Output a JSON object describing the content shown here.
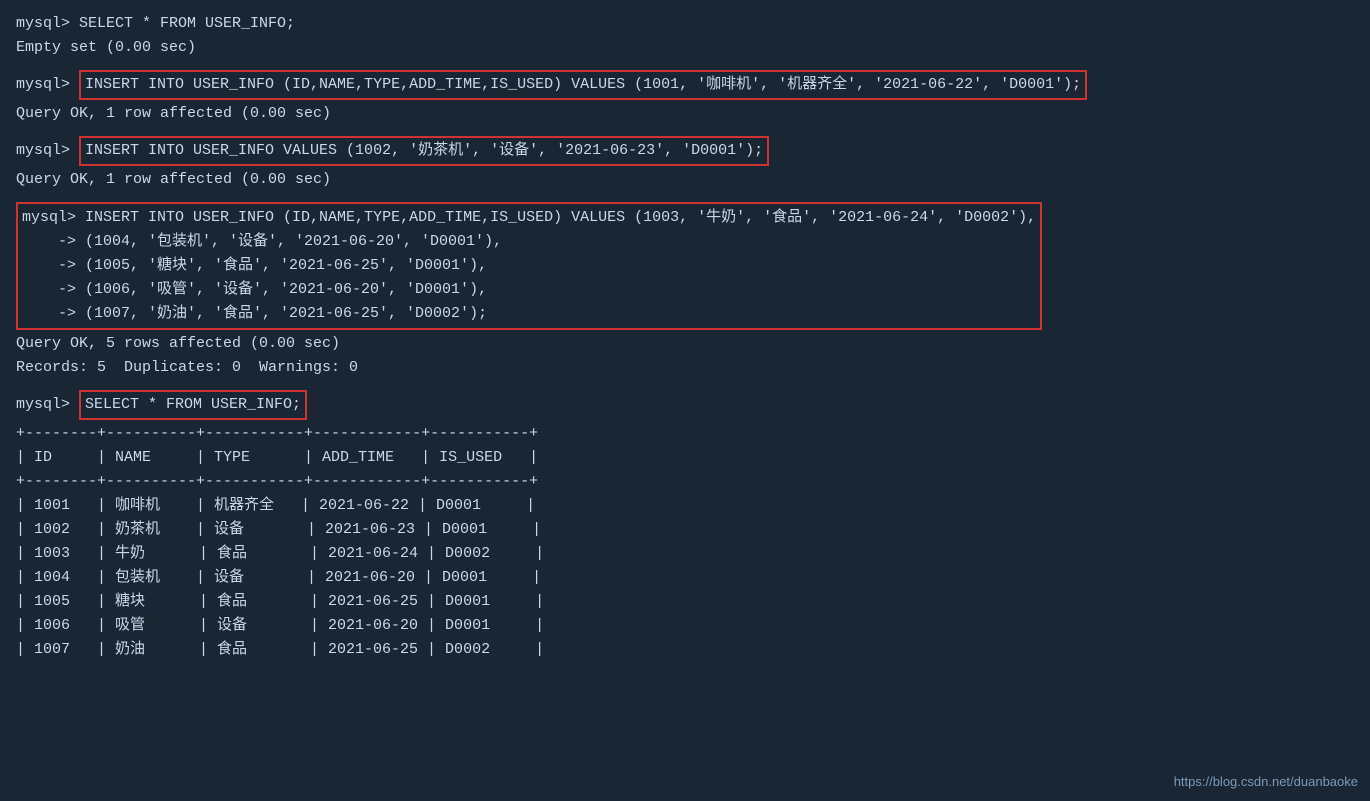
{
  "terminal": {
    "lines": [
      {
        "type": "prompt-line",
        "prompt": "mysql> ",
        "cmd": "SELECT * FROM USER_INFO;",
        "highlight": false
      },
      {
        "type": "result",
        "text": "Empty set (0.00 sec)",
        "highlight": false
      },
      {
        "type": "spacer"
      },
      {
        "type": "prompt-line",
        "prompt": "mysql> ",
        "cmd": "INSERT INTO USER_INFO (ID,NAME,TYPE,ADD_TIME,IS_USED) VALUES (1001, '咖啡机', '机器齐全', '2021-06-22', 'D0001');",
        "highlight": true
      },
      {
        "type": "result",
        "text": "Query OK, 1 row affected (0.00 sec)",
        "highlight": false
      },
      {
        "type": "spacer"
      },
      {
        "type": "prompt-line",
        "prompt": "mysql> ",
        "cmd": "INSERT INTO USER_INFO VALUES (1002, '奶茶机', '设备', '2021-06-23', 'D0001');",
        "highlight": true
      },
      {
        "type": "result",
        "text": "Query OK, 1 row affected (0.00 sec)",
        "highlight": false
      },
      {
        "type": "spacer"
      },
      {
        "type": "multiline-highlight-start",
        "prompt": "mysql> ",
        "cmd": "INSERT INTO USER_INFO (ID,NAME,TYPE,ADD_TIME,IS_USED) VALUES (1003, '牛奶', '食品', '2021-06-24', 'D0002'),"
      },
      {
        "type": "multiline-cont",
        "text": "    -> (1004, '包装机', '设备', '2021-06-20', 'D0001'),"
      },
      {
        "type": "multiline-cont",
        "text": "    -> (1005, '糖块', '食品', '2021-06-25', 'D0001'),"
      },
      {
        "type": "multiline-cont",
        "text": "    -> (1006, '吸管', '设备', '2021-06-20', 'D0001'),"
      },
      {
        "type": "multiline-cont-end",
        "text": "    -> (1007, '奶油', '食品', '2021-06-25', 'D0002');"
      },
      {
        "type": "result",
        "text": "Query OK, 5 rows affected (0.00 sec)",
        "highlight": false
      },
      {
        "type": "result",
        "text": "Records: 5  Duplicates: 0  Warnings: 0",
        "highlight": false
      },
      {
        "type": "spacer"
      },
      {
        "type": "prompt-line",
        "prompt": "mysql> ",
        "cmd": "SELECT * FROM USER_INFO;",
        "highlight": true
      },
      {
        "type": "table-border",
        "text": "+--------+----------+-----------+------------+-----------+"
      },
      {
        "type": "table-header",
        "text": "| ID     | NAME     | TYPE      | ADD_TIME   | IS_USED   |"
      },
      {
        "type": "table-border",
        "text": "+--------+----------+-----------+------------+-----------+"
      },
      {
        "type": "table-row-data",
        "text": "| 1001   | 咖啡机    | 机器齐全   | 2021-06-22 | D0001     |"
      },
      {
        "type": "table-row-data",
        "text": "| 1002   | 奶茶机    | 设备       | 2021-06-23 | D0001     |"
      },
      {
        "type": "table-row-data",
        "text": "| 1003   | 牛奶      | 食品       | 2021-06-24 | D0002     |"
      },
      {
        "type": "table-row-data",
        "text": "| 1004   | 包装机    | 设备       | 2021-06-20 | D0001     |"
      },
      {
        "type": "table-row-data",
        "text": "| 1005   | 糖块      | 食品       | 2021-06-25 | D0001     |"
      },
      {
        "type": "table-row-data",
        "text": "| 1006   | 吸管      | 设备       | 2021-06-20 | D0001     |"
      },
      {
        "type": "table-row-data",
        "text": "| 1007   | 奶油      | 食品       | 2021-06-25 | D0002     |"
      }
    ]
  },
  "watermark": "https://blog.csdn.net/duanbaoke"
}
